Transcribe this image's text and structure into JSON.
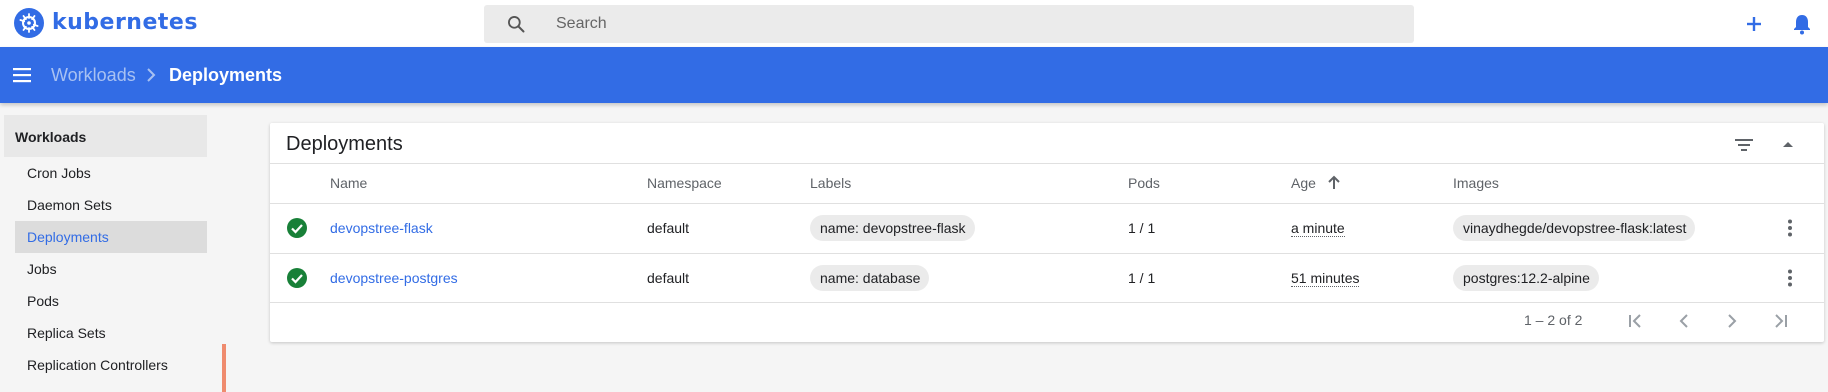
{
  "app": {
    "brand": "kubernetes",
    "search": {
      "placeholder": "Search"
    },
    "icons": {
      "logo": "kubernetes-helm-icon",
      "search": "search-icon",
      "add": "plus-icon",
      "notifications": "bell-icon"
    }
  },
  "navbar": {
    "breadcrumb_parent": "Workloads",
    "breadcrumb_current": "Deployments"
  },
  "sidebar": {
    "header": "Workloads",
    "items": [
      {
        "label": "Cron Jobs"
      },
      {
        "label": "Daemon Sets"
      },
      {
        "label": "Deployments"
      },
      {
        "label": "Jobs"
      },
      {
        "label": "Pods"
      },
      {
        "label": "Replica Sets"
      },
      {
        "label": "Replication Controllers"
      }
    ],
    "active_item": "Deployments"
  },
  "card": {
    "title": "Deployments",
    "columns": {
      "name": "Name",
      "namespace": "Namespace",
      "labels": "Labels",
      "pods": "Pods",
      "age": "Age",
      "images": "Images"
    },
    "rows": [
      {
        "name": "devopstree-flask",
        "namespace": "default",
        "label": "name: devopstree-flask",
        "pods": "1 / 1",
        "age": "a minute",
        "image": "vinaydhegde/devopstree-flask:latest",
        "status": "success"
      },
      {
        "name": "devopstree-postgres",
        "namespace": "default",
        "label": "name: database",
        "pods": "1 / 1",
        "age": "51 minutes",
        "image": "postgres:12.2-alpine",
        "status": "success"
      }
    ],
    "pagination": {
      "range": "1 – 2 of 2"
    }
  },
  "colors": {
    "primary": "#326ce5",
    "success": "#188038",
    "accent": "#ef8b6e"
  }
}
